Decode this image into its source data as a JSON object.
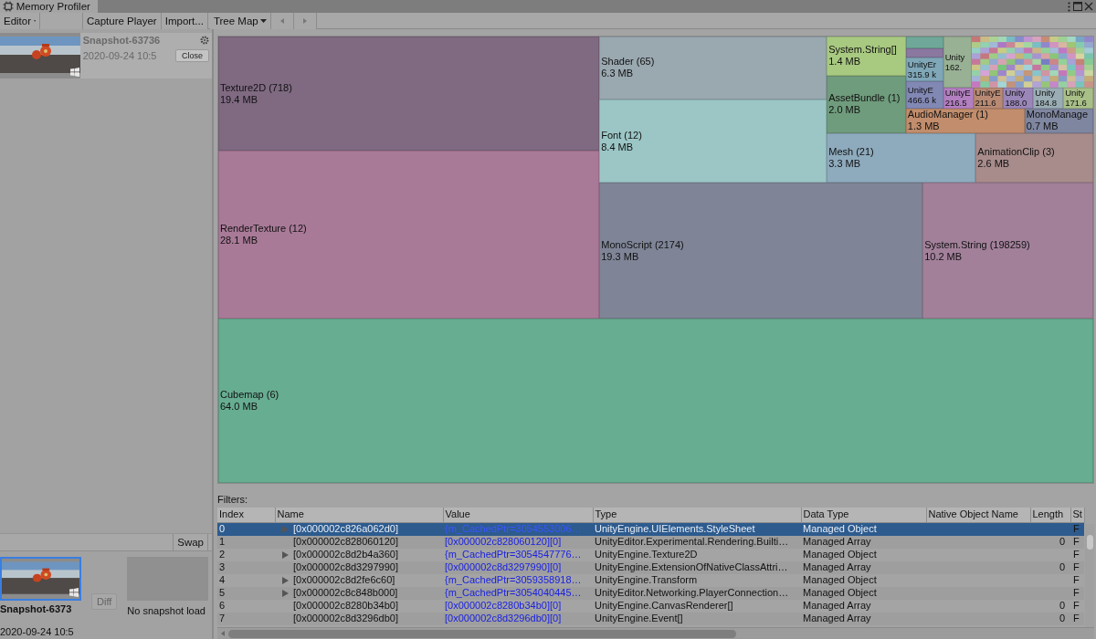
{
  "window": {
    "title": "Memory Profiler"
  },
  "toolbar": {
    "target": "Editor",
    "buttons": [
      "Capture Player",
      "Import..."
    ],
    "view": "Tree Map"
  },
  "snapshots": [
    {
      "name": "Snapshot-63736",
      "date": "2020-09-24 10:5",
      "close": "Close"
    }
  ],
  "compare": {
    "swap": "Swap",
    "diff": {
      "label": "Diff",
      "disabled": true
    },
    "slots": [
      {
        "kind": "snapshot",
        "name": "Snapshot-6373",
        "date": "2020-09-24 10:5",
        "selected": true
      },
      {
        "kind": "empty",
        "name": "No snapshot load",
        "selected": false
      }
    ]
  },
  "treemap": {
    "tiles": [
      {
        "label": "Texture2D (718)",
        "size": "19.4 MB",
        "color": "#7f6a82"
      },
      {
        "label": "RenderTexture (12)",
        "size": "28.1 MB",
        "color": "#a97a98"
      },
      {
        "label": "Shader (65)",
        "size": "6.3 MB",
        "color": "#9aa8b0"
      },
      {
        "label": "Font (12)",
        "size": "8.4 MB",
        "color": "#9cc6c6"
      },
      {
        "label": "System.String[]",
        "size": "1.4 MB",
        "color": "#a8c980"
      },
      {
        "label": "AssetBundle (1)",
        "size": "2.0 MB",
        "color": "#6f9c7c"
      },
      {
        "label": "UnityEr",
        "size": "315.9 k",
        "color": "#7fa7b8"
      },
      {
        "label": "UnityE",
        "size": "466.6 k",
        "color": "#8288b4"
      },
      {
        "label": "Unity",
        "size": "162.",
        "color": "#98b094"
      },
      {
        "label": "UnityE",
        "size": "216.5",
        "color": "#b27fc0"
      },
      {
        "label": "UnityE",
        "size": "211.6",
        "color": "#b88a74"
      },
      {
        "label": "Unity",
        "size": "188.0",
        "color": "#9a86b8"
      },
      {
        "label": "Unity",
        "size": "184.8",
        "color": "#9aacb4"
      },
      {
        "label": "Unity",
        "size": "171.6",
        "color": "#a8bf88"
      },
      {
        "label": "AudioManager (1)",
        "size": "1.3 MB",
        "color": "#c18d6c"
      },
      {
        "label": "MonoManage",
        "size": "0.7 MB",
        "color": "#7f86a0"
      },
      {
        "label": "Mesh (21)",
        "size": "3.3 MB",
        "color": "#8eaabd"
      },
      {
        "label": "AnimationClip (3)",
        "size": "2.6 MB",
        "color": "#a88c8c"
      },
      {
        "label": "MonoScript (2174)",
        "size": "19.3 MB",
        "color": "#7f8597"
      },
      {
        "label": "System.String (198259)",
        "size": "10.2 MB",
        "color": "#a2809a"
      },
      {
        "label": "Cubemap (6)",
        "size": "64.0 MB",
        "color": "#67ad91"
      }
    ]
  },
  "table": {
    "filters_label": "Filters:",
    "columns": [
      "Index",
      "Name",
      "Value",
      "Type",
      "Data Type",
      "Native Object Name",
      "Length",
      "St"
    ],
    "rows": [
      {
        "index": "0",
        "name": "[0x000002c826a062d0]",
        "expandable": true,
        "value": "{m_CachedPtr=3054553006…",
        "type": "UnityEngine.UIElements.StyleSheet",
        "data_type": "Managed Object",
        "native_object_name": "",
        "length": "",
        "column_8": "F",
        "selected": true
      },
      {
        "index": "1",
        "name": "[0x000002c828060120]",
        "expandable": false,
        "value": "[0x000002c828060120][0]",
        "type": "UnityEditor.Experimental.Rendering.Builti…",
        "data_type": "Managed Array",
        "native_object_name": "",
        "length": "0",
        "column_8": "F",
        "selected": false
      },
      {
        "index": "2",
        "name": "[0x000002c8d2b4a360]",
        "expandable": true,
        "value": "{m_CachedPtr=3054547776…",
        "type": "UnityEngine.Texture2D",
        "data_type": "Managed Object",
        "native_object_name": "",
        "length": "",
        "column_8": "F",
        "selected": false
      },
      {
        "index": "3",
        "name": "[0x000002c8d3297990]",
        "expandable": false,
        "value": "[0x000002c8d3297990][0]",
        "type": "UnityEngine.ExtensionOfNativeClassAttri…",
        "data_type": "Managed Array",
        "native_object_name": "",
        "length": "0",
        "column_8": "F",
        "selected": false
      },
      {
        "index": "4",
        "name": "[0x000002c8d2fe6c60]",
        "expandable": true,
        "value": "{m_CachedPtr=3059358918…",
        "type": "UnityEngine.Transform",
        "data_type": "Managed Object",
        "native_object_name": "",
        "length": "",
        "column_8": "F",
        "selected": false
      },
      {
        "index": "5",
        "name": "[0x000002c8c848b000]",
        "expandable": true,
        "value": "{m_CachedPtr=3054040445…",
        "type": "UnityEditor.Networking.PlayerConnection…",
        "data_type": "Managed Object",
        "native_object_name": "",
        "length": "",
        "column_8": "F",
        "selected": false
      },
      {
        "index": "6",
        "name": "[0x000002c8280b34b0]",
        "expandable": false,
        "value": "[0x000002c8280b34b0][0]",
        "type": "UnityEngine.CanvasRenderer[]",
        "data_type": "Managed Array",
        "native_object_name": "",
        "length": "0",
        "column_8": "F",
        "selected": false
      },
      {
        "index": "7",
        "name": "[0x000002c8d3296db0]",
        "expandable": false,
        "value": "[0x000002c8d3296db0][0]",
        "type": "UnityEngine.Event[]",
        "data_type": "Managed Array",
        "native_object_name": "",
        "length": "0",
        "column_8": "F",
        "selected": false
      }
    ]
  }
}
